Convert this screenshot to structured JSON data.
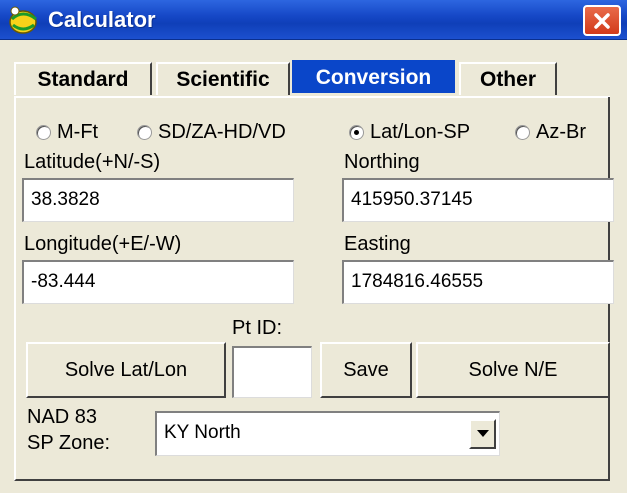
{
  "window": {
    "title": "Calculator",
    "close_label": "✕"
  },
  "tabs": [
    {
      "label": "Standard",
      "active": false
    },
    {
      "label": "Scientific",
      "active": false
    },
    {
      "label": "Conversion",
      "active": true
    },
    {
      "label": "Other",
      "active": false
    }
  ],
  "radios": [
    {
      "label": "M-Ft",
      "checked": false
    },
    {
      "label": "SD/ZA-HD/VD",
      "checked": false
    },
    {
      "label": "Lat/Lon-SP",
      "checked": true
    },
    {
      "label": "Az-Br",
      "checked": false
    }
  ],
  "fields": {
    "latitude": {
      "label": "Latitude(+N/-S)",
      "value": "38.3828"
    },
    "northing": {
      "label": "Northing",
      "value": "415950.37145"
    },
    "longitude": {
      "label": "Longitude(+E/-W)",
      "value": "-83.444"
    },
    "easting": {
      "label": "Easting",
      "value": "1784816.46555"
    }
  },
  "point": {
    "label": "Pt ID:",
    "value": ""
  },
  "buttons": {
    "solve_latlon": "Solve Lat/Lon",
    "save": "Save",
    "solve_ne": "Solve N/E"
  },
  "zone": {
    "label_line1": "NAD 83",
    "label_line2": "SP Zone:",
    "selected": "KY North"
  },
  "colors": {
    "titlebar": "#1648c7",
    "active_tab": "#0a46c9",
    "close": "#d23a1a",
    "window_bg": "#ece9d8"
  },
  "icons": {
    "app": "globe-icon",
    "close": "close-icon",
    "dropdown": "chevron-down-icon"
  }
}
